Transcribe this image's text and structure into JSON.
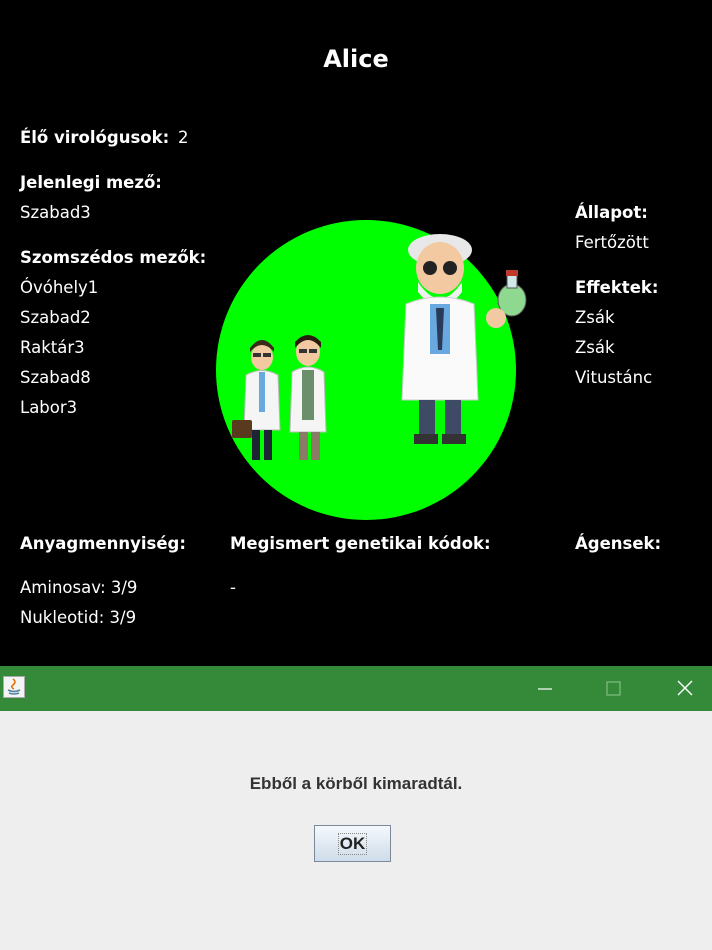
{
  "player": {
    "name": "Alice"
  },
  "alive": {
    "label": "Élő virológusok:",
    "value": "2"
  },
  "current_field": {
    "label": "Jelenlegi mező:",
    "value": "Szabad3"
  },
  "neighbors": {
    "label": "Szomszédos mezők:",
    "items": [
      "Óvóhely1",
      "Szabad2",
      "Raktár3",
      "Szabad8",
      "Labor3"
    ]
  },
  "state": {
    "label": "Állapot:",
    "value": "Fertőzött"
  },
  "effects": {
    "label": "Effektek:",
    "items": [
      "Zsák",
      "Zsák",
      "Vitustánc"
    ]
  },
  "materials": {
    "label": "Anyagmennyiség:",
    "items": [
      "Aminosav: 3/9",
      "Nukleotid: 3/9"
    ]
  },
  "codes": {
    "label": "Megismert genetikai kódok:",
    "items": [
      "-"
    ]
  },
  "agents": {
    "label": "Ágensek:"
  },
  "dialog": {
    "message": "Ebből a körből kimaradtál.",
    "ok_label": "OK",
    "titlebar_color": "#358a3a",
    "icons": [
      "java-icon",
      "minimize-icon",
      "maximize-icon",
      "close-icon"
    ]
  },
  "colors": {
    "background": "#000000",
    "field_circle": "#00ff00"
  }
}
